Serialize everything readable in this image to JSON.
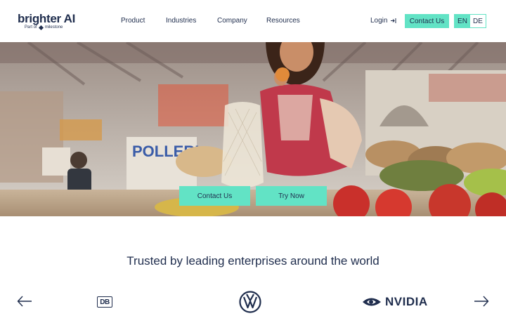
{
  "header": {
    "logo_text": "brighter AI",
    "logo_sub_prefix": "Part of",
    "logo_sub_brand": "milestone",
    "nav": [
      "Product",
      "Industries",
      "Company",
      "Resources"
    ],
    "login_label": "Login",
    "contact_label": "Contact Us",
    "languages": [
      {
        "label": "EN",
        "active": true
      },
      {
        "label": "DE",
        "active": false
      }
    ]
  },
  "hero": {
    "contact_label": "Contact Us",
    "try_label": "Try Now",
    "sign_text": "POLLERI"
  },
  "trusted": {
    "title": "Trusted by leading enterprises around the world",
    "logos": [
      "DB",
      "Volkswagen",
      "NVIDIA"
    ],
    "nvidia_word": "NVIDIA",
    "db_word": "DB"
  },
  "colors": {
    "accent": "#62e3c5",
    "text": "#1f2d4d"
  }
}
